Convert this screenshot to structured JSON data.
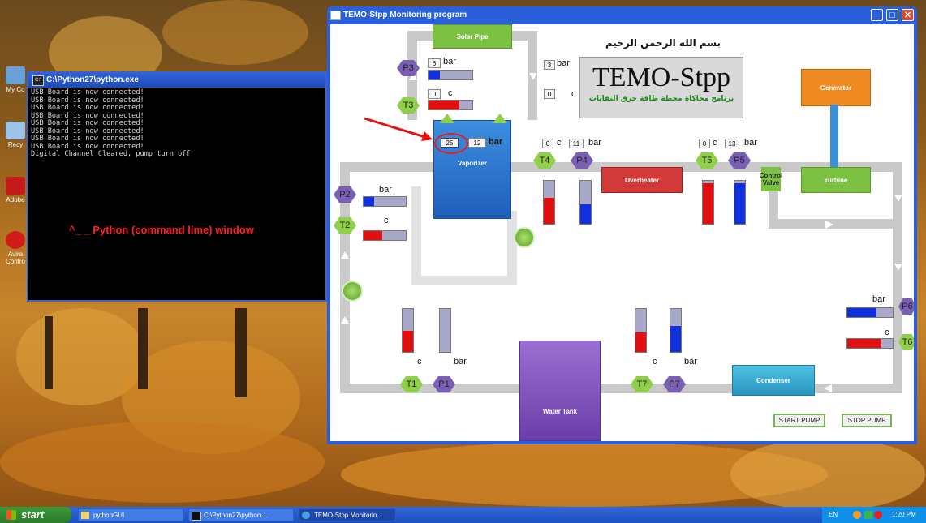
{
  "desktop": {
    "icons": [
      {
        "label": "My Co"
      },
      {
        "label": "Recy"
      },
      {
        "label": "Adobe"
      },
      {
        "label": "Avira Contro"
      }
    ]
  },
  "python_window": {
    "title": "C:\\Python27\\python.exe",
    "icon_text": "C:\\",
    "console_lines": [
      "USB Board is now connected!",
      "USB Board is now connected!",
      "USB Board is now connected!",
      "USB Board is now connected!",
      "USB Board is now connected!",
      "USB Board is now connected!",
      "USB Board is now connected!",
      "USB Board is now connected!",
      "Digital Channel Cleared, pump turn off"
    ],
    "caption": "^_ _ Python (command lime) window"
  },
  "main_window": {
    "title": "TEMO-Stpp Monitoring program",
    "arabic_header": "بسم الله الرحمن الرحيم",
    "logo_title": "TEMO-Stpp",
    "logo_subtitle": "برنامج محاكاة محطة طاقة حرق النفايات",
    "components": {
      "solar_pipe": "Solar Pipe",
      "vaporizer": "Vaporizer",
      "overheater": "Overheater",
      "generator": "Generator",
      "turbine": "Turbine",
      "control_valve": "Control Valve",
      "condenser": "Condenser",
      "water_tank": "Water Tank"
    },
    "sensors": {
      "p1": "P1",
      "p2": "P2",
      "p3": "P3",
      "p4": "P4",
      "p5": "P5",
      "p6": "P6",
      "p7": "P7",
      "t1": "T1",
      "t2": "T2",
      "t3": "T3",
      "t4": "T4",
      "t5": "T5",
      "t6": "T6",
      "t7": "T7"
    },
    "units": {
      "bar": "bar",
      "c": "c"
    },
    "readings": {
      "p3_value": "6",
      "t3_value": "0",
      "solar_bar_value": "3",
      "solar_c_value": "0",
      "vaporizer_temp": "25",
      "vaporizer_pressure": "12",
      "t4_value": "0",
      "p4_value": "11",
      "t5_value": "0",
      "p5_value": "13"
    },
    "levels": {
      "p3": 0.25,
      "t3": 0.7,
      "p2": 0.25,
      "t2": 0.45,
      "p6": 0.65,
      "t6": 0.75,
      "t4": 0.6,
      "p4": 0.45,
      "t5": 0.95,
      "p5": 0.95,
      "t1": 0.5,
      "p1": 0.0,
      "t7": 0.45,
      "p7": 0.6
    },
    "buttons": {
      "start": "START PUMP",
      "stop": "STOP PUMP"
    },
    "colors": {
      "pressure": "#1030e0",
      "temperature": "#e01010"
    }
  },
  "taskbar": {
    "start": "start",
    "tasks": [
      "pythonGUI",
      "C:\\Python27\\python....",
      "TEMO-Stpp Monitorin..."
    ],
    "lang": "EN",
    "clock": "1:20 PM"
  }
}
